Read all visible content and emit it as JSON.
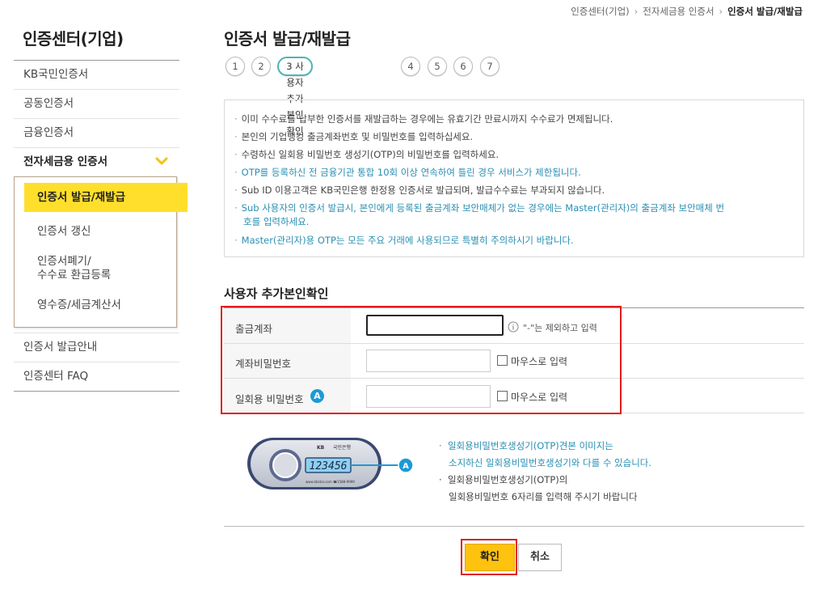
{
  "breadcrumb": {
    "items": [
      "인증센터(기업)",
      "전자세금용 인증서",
      "인증서 발급/재발급"
    ]
  },
  "sidebar": {
    "title": "인증센터(기업)",
    "items": [
      {
        "label": "KB국민인증서"
      },
      {
        "label": "공동인증서"
      },
      {
        "label": "금융인증서"
      },
      {
        "label": "전자세금용 인증서"
      }
    ],
    "sub_items": [
      {
        "label": "인증서 발급/재발급"
      },
      {
        "label": "인증서 갱신"
      },
      {
        "label": "인증서폐기/"
      },
      {
        "label": "수수료 환급등록"
      },
      {
        "label": "영수증/세금계산서"
      }
    ],
    "bottom_items": [
      {
        "label": "인증서 발급안내"
      },
      {
        "label": "인증센터 FAQ"
      }
    ]
  },
  "main": {
    "title": "인증서 발급/재발급",
    "steps": [
      "1",
      "2",
      "3 사용자 추가본인확인",
      "4",
      "5",
      "6",
      "7"
    ],
    "notices": [
      "이미 수수료를 납부한 인증서를 재발급하는 경우에는 유효기간 만료시까지 수수료가 면제됩니다.",
      "본인의 기업뱅킹 출금계좌번호 및 비밀번호를 입력하십세요.",
      "수령하신 일회용 비밀번호 생성기(OTP)의 비밀번호를 입력하세요.",
      "OTP를 등록하신 전 금융기관 통합 10회 이상 연속하여 틀린 경우 서비스가 제한됩니다.",
      "Sub ID 이용고객은 KB국민은행 한정용 인증서로 발급되며, 발급수수료는 부과되지 않습니다.",
      "Sub 사용자의 인증서 발급시, 본인에게 등록된 출금계좌 보안매체가 없는 경우에는 Master(관리자)의 출금계좌 보안매체 번",
      "호를 입력하세요.",
      "Master(관리자)용 OTP는 모든 주요 거래에 사용되므로 특별히 주의하시기 바랍니다."
    ],
    "section_title": "사용자 추가본인확인",
    "form": {
      "account_label": "출금계좌",
      "account_hint": "\"-\"는 제외하고 입력",
      "password_label": "계좌비밀번호",
      "otp_label": "일회용 비밀번호",
      "mouse_input_label": "마우스로 입력",
      "badge": "A"
    },
    "otp_info": {
      "line1": "일회용비밀번호생성기(OTP)견본 이미지는",
      "line2": "소지하신 일회용비밀번호생성기와 다를 수 있습니다.",
      "line3": "일회용비밀번호생성기(OTP)의",
      "line4": "일회용비밀번호 6자리를 입력해 주시기 바랍니다",
      "device_display": "123456",
      "device_brand": "KB",
      "device_bank": "국민은행",
      "device_url": "www.kbstar.com  ☎1588-9999"
    },
    "buttons": {
      "confirm": "확인",
      "cancel": "취소"
    }
  },
  "colors": {
    "accent_yellow": "#ffdf2b",
    "button_yellow": "#ffc20e",
    "highlight_red": "#e21b1b",
    "teal": "#4fb3b6",
    "info_blue": "#2a8fb3"
  }
}
